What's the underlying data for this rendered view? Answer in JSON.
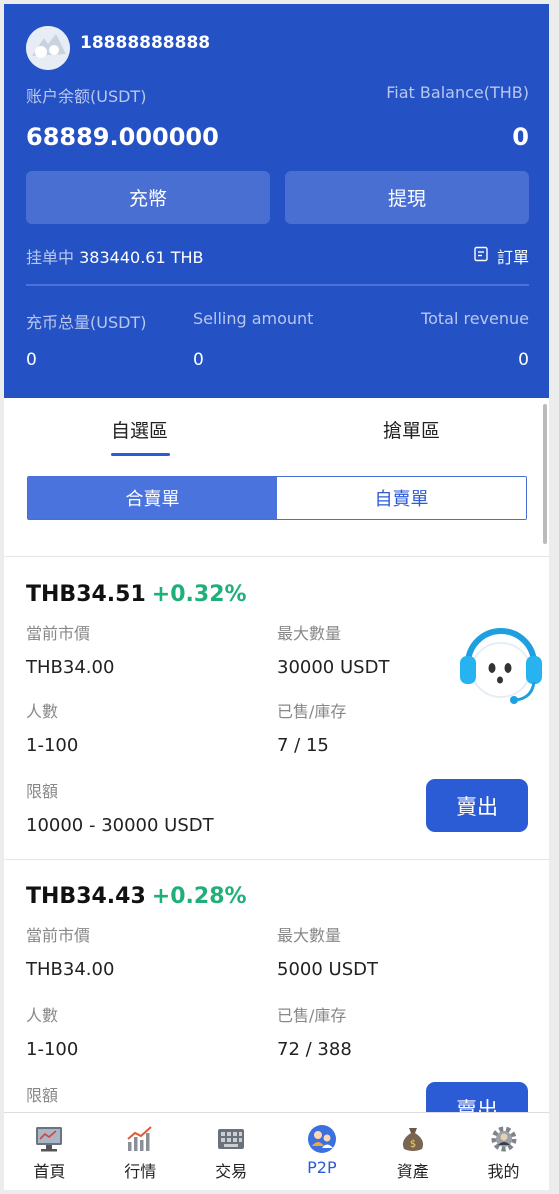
{
  "header": {
    "phone": "18888888888",
    "account_label": "账户余额(USDT)",
    "fiat_label": "Fiat Balance(THB)",
    "account_balance": "68889.000000",
    "fiat_balance": "0",
    "deposit_btn": "充幣",
    "withdraw_btn": "提現",
    "pending_key": "挂单中",
    "pending_value": "383440.61 THB",
    "orders_label": "訂單",
    "stats": [
      {
        "label": "充币总量(USDT)",
        "value": "0"
      },
      {
        "label": "Selling amount",
        "value": "0"
      },
      {
        "label": "Total revenue",
        "value": "0"
      }
    ]
  },
  "tabs": [
    "自選區",
    "搶單區"
  ],
  "segment": [
    "合賣單",
    "自賣單"
  ],
  "cards": [
    {
      "price": "THB34.51",
      "change": "+0.32%",
      "k_market": "當前市價",
      "v_market": "THB34.00",
      "k_max": "最大數量",
      "v_max": "30000 USDT",
      "k_people": "人數",
      "v_people": "1-100",
      "k_sold": "已售/庫存",
      "v_sold": "7 / 15",
      "k_limit": "限額",
      "v_limit": "10000 - 30000 USDT",
      "sell_btn": "賣出"
    },
    {
      "price": "THB34.43",
      "change": "+0.28%",
      "k_market": "當前市價",
      "v_market": "THB34.00",
      "k_max": "最大數量",
      "v_max": "5000 USDT",
      "k_people": "人數",
      "v_people": "1-100",
      "k_sold": "已售/庫存",
      "v_sold": "72 / 388",
      "k_limit": "限額",
      "sell_btn": "賣出"
    }
  ],
  "nav": [
    {
      "label": "首頁",
      "icon": "home-monitor-icon"
    },
    {
      "label": "行情",
      "icon": "market-chart-icon"
    },
    {
      "label": "交易",
      "icon": "trade-keyboard-icon"
    },
    {
      "label": "P2P",
      "icon": "p2p-users-icon",
      "active": true
    },
    {
      "label": "資產",
      "icon": "money-bag-icon"
    },
    {
      "label": "我的",
      "icon": "profile-gear-icon"
    }
  ],
  "colors": {
    "header_bg": "#2451c3",
    "accent": "#2c5bd6",
    "positive": "#1fb07a"
  }
}
